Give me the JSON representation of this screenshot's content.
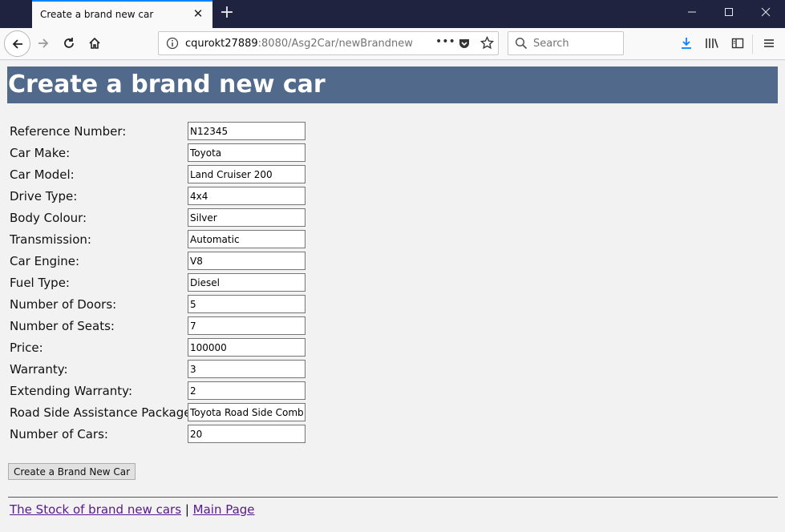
{
  "browser": {
    "tab_title": "Create a brand new car",
    "url_host": "cqurokt27889",
    "url_rest": ":8080/Asg2Car/newBrandnew",
    "search_placeholder": "Search",
    "accent_color": "#0a84ff",
    "icons": [
      "back-icon",
      "forward-icon",
      "reload-icon",
      "home-icon",
      "info-icon",
      "more-icon",
      "pocket-icon",
      "star-icon",
      "search-icon",
      "download-icon",
      "library-icon",
      "sidebar-icon",
      "menu-icon"
    ]
  },
  "page": {
    "heading": "Create a brand new car",
    "heading_bg": "#51698a",
    "fields": [
      {
        "label": "Reference Number:",
        "value": "N12345"
      },
      {
        "label": "Car Make:",
        "value": "Toyota"
      },
      {
        "label": "Car Model:",
        "value": "Land Cruiser 200"
      },
      {
        "label": "Drive Type:",
        "value": "4x4"
      },
      {
        "label": "Body Colour:",
        "value": "Silver"
      },
      {
        "label": "Transmission:",
        "value": "Automatic"
      },
      {
        "label": "Car Engine:",
        "value": "V8"
      },
      {
        "label": "Fuel Type:",
        "value": "Diesel"
      },
      {
        "label": "Number of Doors:",
        "value": "5"
      },
      {
        "label": "Number of Seats:",
        "value": "7"
      },
      {
        "label": "Price:",
        "value": "100000"
      },
      {
        "label": "Warranty:",
        "value": "3"
      },
      {
        "label": "Extending Warranty:",
        "value": "2"
      },
      {
        "label": "Road Side Assistance Package:",
        "value": "Toyota Road Side Combo"
      },
      {
        "label": "Number of Cars:",
        "value": "20"
      }
    ],
    "submit_label": "Create a Brand New Car",
    "footer": {
      "link1": "The Stock of brand new cars",
      "separator": " | ",
      "link2": "Main Page"
    }
  }
}
